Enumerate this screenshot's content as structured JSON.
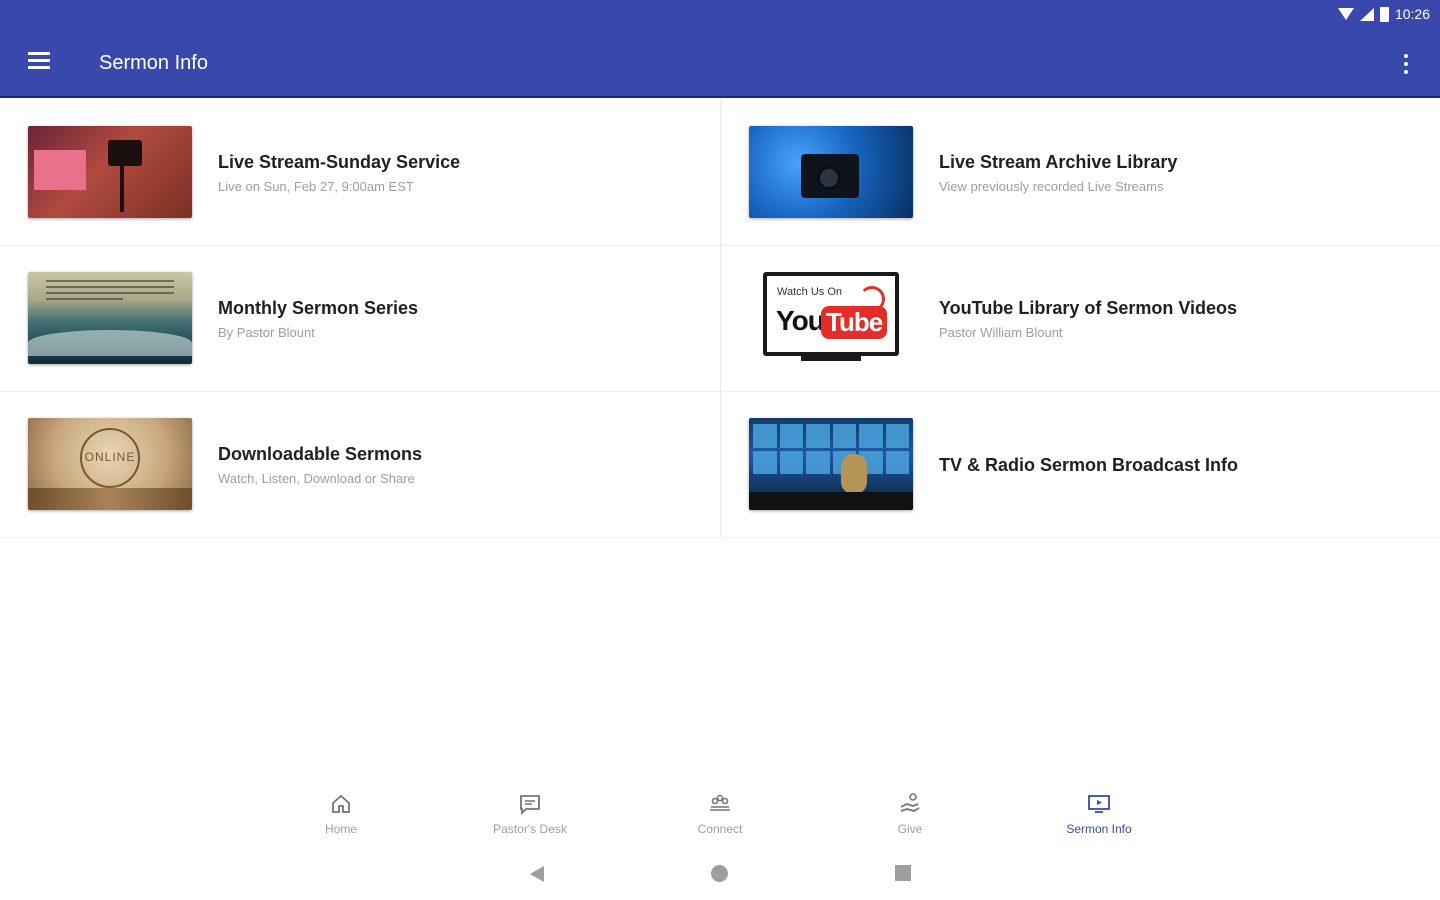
{
  "status_bar": {
    "time": "10:26"
  },
  "app_bar": {
    "title": "Sermon Info"
  },
  "cards": [
    {
      "title": "Live Stream-Sunday Service",
      "subtitle": "Live on Sun, Feb 27, 9:00am EST"
    },
    {
      "title": "Live Stream Archive Library",
      "subtitle": "View previously recorded Live Streams"
    },
    {
      "title": "Monthly Sermon Series",
      "subtitle": "By Pastor Blount"
    },
    {
      "title": "YouTube Library of Sermon Videos",
      "subtitle": "Pastor William Blount"
    },
    {
      "title": "Downloadable Sermons",
      "subtitle": "Watch, Listen, Download or Share"
    },
    {
      "title": "TV & Radio Sermon Broadcast Info",
      "subtitle": ""
    }
  ],
  "thumbnails": {
    "youtube_watch": "Watch Us On",
    "youtube_you": "You",
    "youtube_tube": "Tube",
    "sermons_online": "ONLINE"
  },
  "bottom_nav": {
    "items": [
      {
        "label": "Home",
        "icon": "home-icon"
      },
      {
        "label": "Pastor's Desk",
        "icon": "message-icon"
      },
      {
        "label": "Connect",
        "icon": "people-icon"
      },
      {
        "label": "Give",
        "icon": "give-hand-icon"
      },
      {
        "label": "Sermon Info",
        "icon": "monitor-play-icon"
      }
    ],
    "active": "Sermon Info"
  },
  "colors": {
    "primary": "#3949ab",
    "primary_dark": "#1a237e",
    "inactive": "#9e9e9e",
    "youtube_red": "#e52d27"
  }
}
